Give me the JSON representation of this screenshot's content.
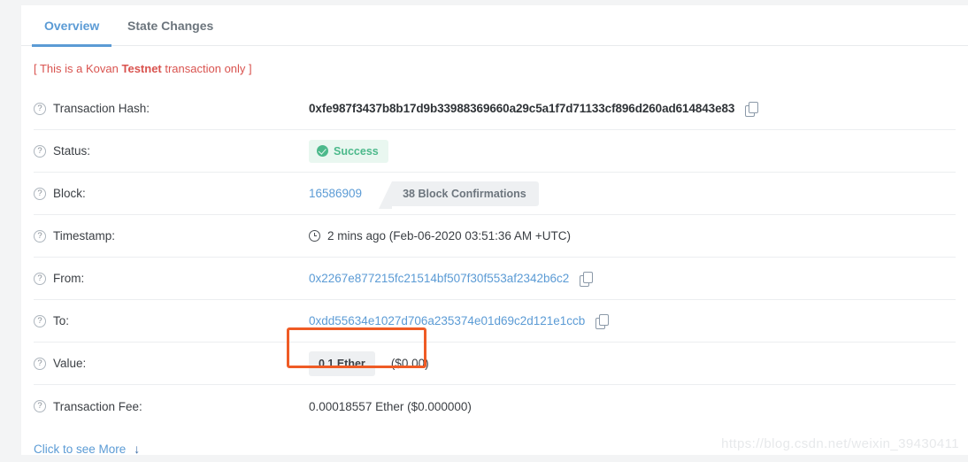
{
  "tabs": [
    {
      "label": "Overview",
      "active": true
    },
    {
      "label": "State Changes",
      "active": false
    }
  ],
  "notice": {
    "prefix": "[ This is a Kovan ",
    "emphasis": "Testnet",
    "suffix": " transaction only ]"
  },
  "rows": {
    "transaction_hash": {
      "label": "Transaction Hash:",
      "value": "0xfe987f3437b8b17d9b33988369660a29c5a1f7d71133cf896d260ad614843e83",
      "copy_icon": "copy-icon"
    },
    "status": {
      "label": "Status:",
      "value": "Success",
      "icon": "check-circle-icon"
    },
    "block": {
      "label": "Block:",
      "number": "16586909",
      "confirmations": "38 Block Confirmations"
    },
    "timestamp": {
      "label": "Timestamp:",
      "icon": "clock-icon",
      "value": "2 mins ago (Feb-06-2020 03:51:36 AM +UTC)"
    },
    "from": {
      "label": "From:",
      "value": "0x2267e877215fc21514bf507f30f553af2342b6c2",
      "copy_icon": "copy-icon"
    },
    "to": {
      "label": "To:",
      "value": "0xdd55634e1027d706a235374e01d69c2d121e1ccb",
      "copy_icon": "copy-icon"
    },
    "value": {
      "label": "Value:",
      "ether": "0.1 Ether",
      "usd": "($0.00)"
    },
    "transaction_fee": {
      "label": "Transaction Fee:",
      "value": "0.00018557 Ether ($0.000000)"
    }
  },
  "footer": {
    "more_label": "Click to see More",
    "more_arrow": "↓"
  },
  "watermark": "https://blog.csdn.net/weixin_39430411",
  "help_icon_glyph": "?",
  "colors": {
    "accent_blue": "#5b9bd5",
    "success_green": "#4cb98b",
    "notice_red": "#d9534f",
    "annotation_orange": "#ef5b25",
    "badge_grey": "#eef0f2"
  }
}
